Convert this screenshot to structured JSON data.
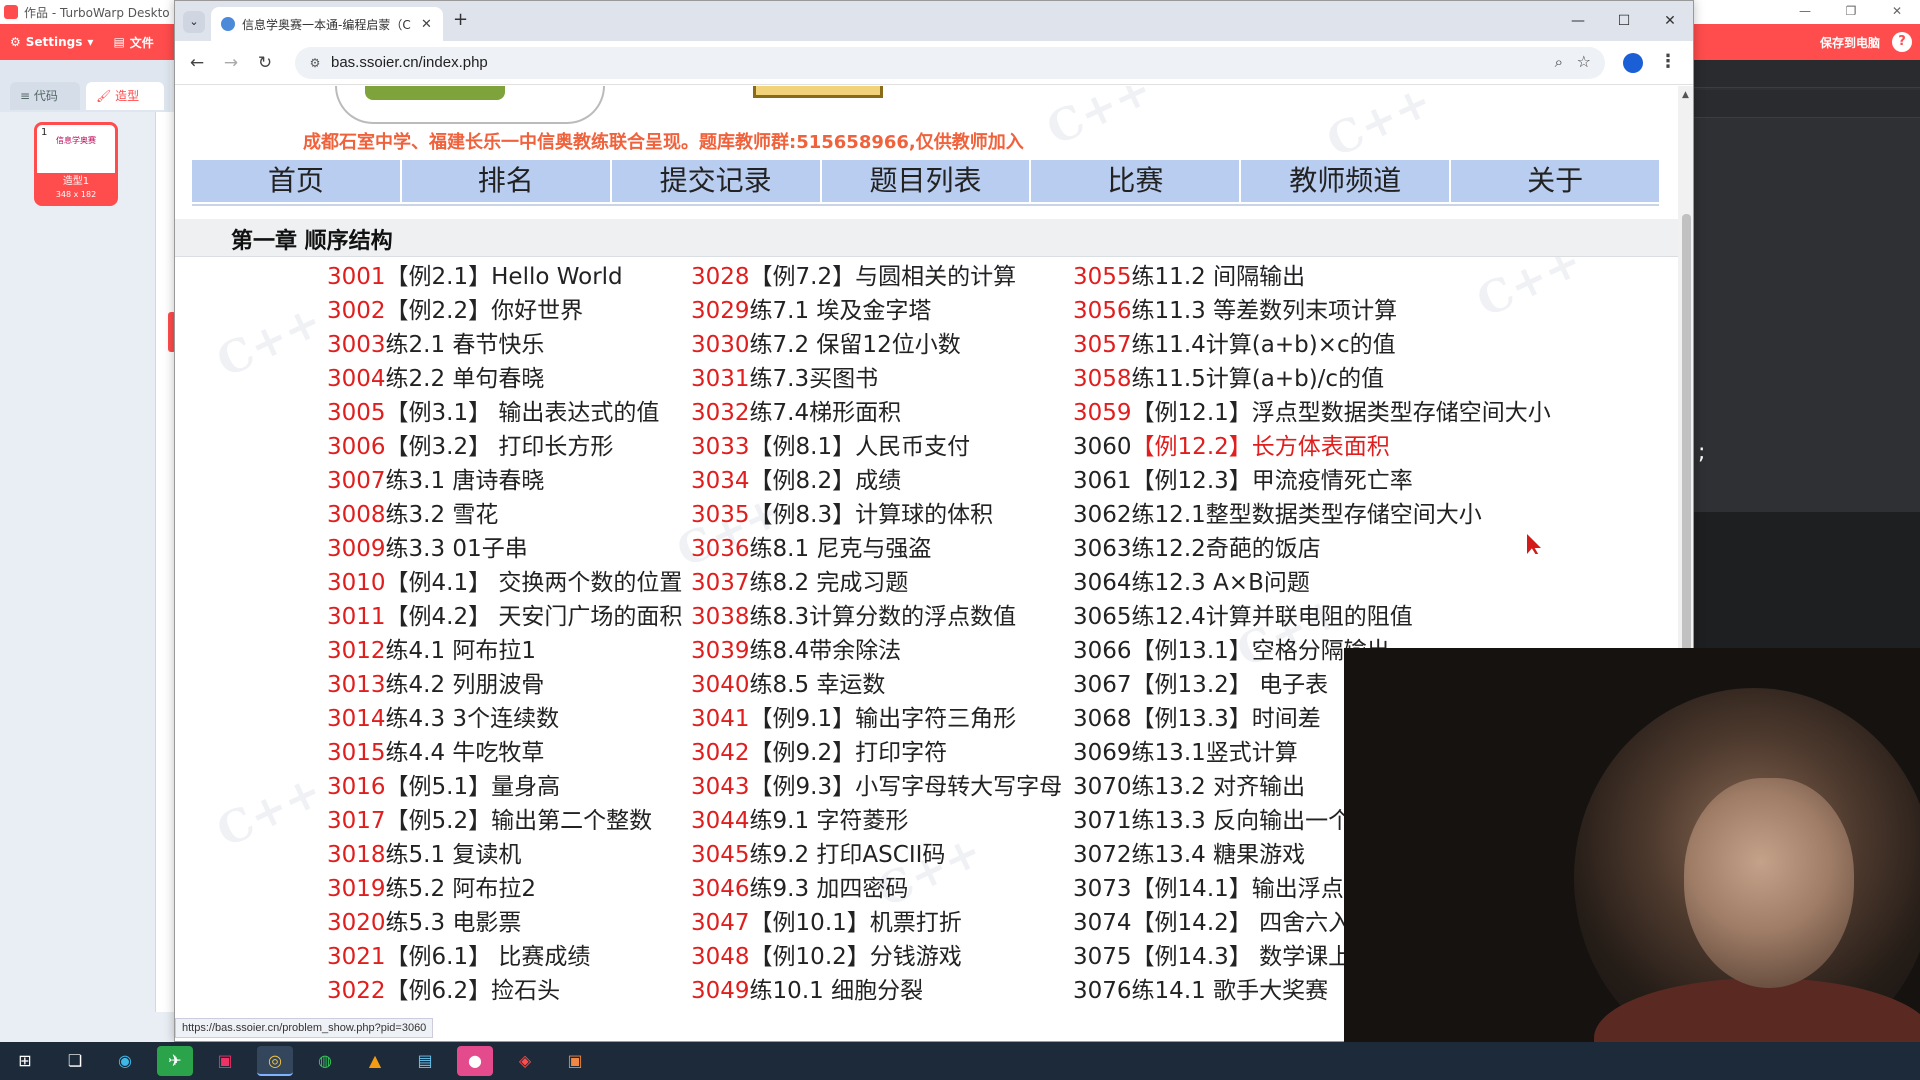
{
  "turbowarp": {
    "window_title": "作品 - TurboWarp Deskto",
    "menu": {
      "settings": "Settings",
      "file": "文件",
      "save_to_computer": "保存到电脑",
      "help": "?"
    },
    "tabs": {
      "code": "代码",
      "costume": "造型"
    },
    "costume": {
      "number": "1",
      "thumb_text": "信息学奥赛",
      "name": "造型1",
      "size": "348 x 182"
    },
    "semicolon": ";",
    "colors": {
      "accent": "#ff4c4c"
    }
  },
  "browser": {
    "tab_title": "信息学奥赛一本通-编程启蒙（C",
    "address": "bas.ssoier.cn/index.php",
    "status_url": "https://bas.ssoier.cn/problem_show.php?pid=3060"
  },
  "page": {
    "banner_text": "成都石室中学、福建长乐一中信奥教练联合呈现。题库教师群:515658966,仅供教师加入",
    "nav": [
      "首页",
      "排名",
      "提交记录",
      "题目列表",
      "比赛",
      "教师频道",
      "关于"
    ],
    "chapter_title": "第一章 顺序结构",
    "columns": [
      [
        {
          "id": "3001",
          "title": "【例2.1】Hello World"
        },
        {
          "id": "3002",
          "title": "【例2.2】你好世界"
        },
        {
          "id": "3003",
          "title": "练2.1 春节快乐"
        },
        {
          "id": "3004",
          "title": "练2.2 单句春晓"
        },
        {
          "id": "3005",
          "title": "【例3.1】 输出表达式的值"
        },
        {
          "id": "3006",
          "title": "【例3.2】 打印长方形"
        },
        {
          "id": "3007",
          "title": "练3.1 唐诗春晓"
        },
        {
          "id": "3008",
          "title": "练3.2 雪花"
        },
        {
          "id": "3009",
          "title": "练3.3 01子串"
        },
        {
          "id": "3010",
          "title": "【例4.1】 交换两个数的位置"
        },
        {
          "id": "3011",
          "title": "【例4.2】 天安门广场的面积"
        },
        {
          "id": "3012",
          "title": "练4.1 阿布拉1"
        },
        {
          "id": "3013",
          "title": "练4.2 列朋波骨"
        },
        {
          "id": "3014",
          "title": "练4.3 3个连续数"
        },
        {
          "id": "3015",
          "title": "练4.4 牛吃牧草"
        },
        {
          "id": "3016",
          "title": "【例5.1】量身高"
        },
        {
          "id": "3017",
          "title": "【例5.2】输出第二个整数"
        },
        {
          "id": "3018",
          "title": "练5.1 复读机"
        },
        {
          "id": "3019",
          "title": "练5.2 阿布拉2"
        },
        {
          "id": "3020",
          "title": "练5.3 电影票"
        },
        {
          "id": "3021",
          "title": "【例6.1】 比赛成绩"
        },
        {
          "id": "3022",
          "title": "【例6.2】捡石头"
        }
      ],
      [
        {
          "id": "3028",
          "title": "【例7.2】与圆相关的计算"
        },
        {
          "id": "3029",
          "title": "练7.1 埃及金字塔"
        },
        {
          "id": "3030",
          "title": "练7.2 保留12位小数"
        },
        {
          "id": "3031",
          "title": "练7.3买图书"
        },
        {
          "id": "3032",
          "title": "练7.4梯形面积"
        },
        {
          "id": "3033",
          "title": "【例8.1】人民币支付"
        },
        {
          "id": "3034",
          "title": "【例8.2】成绩"
        },
        {
          "id": "3035",
          "title": "【例8.3】计算球的体积"
        },
        {
          "id": "3036",
          "title": "练8.1 尼克与强盗"
        },
        {
          "id": "3037",
          "title": "练8.2 完成习题"
        },
        {
          "id": "3038",
          "title": "练8.3计算分数的浮点数值"
        },
        {
          "id": "3039",
          "title": "练8.4带余除法"
        },
        {
          "id": "3040",
          "title": "练8.5 幸运数"
        },
        {
          "id": "3041",
          "title": "【例9.1】输出字符三角形"
        },
        {
          "id": "3042",
          "title": "【例9.2】打印字符"
        },
        {
          "id": "3043",
          "title": "【例9.3】小写字母转大写字母"
        },
        {
          "id": "3044",
          "title": "练9.1 字符菱形"
        },
        {
          "id": "3045",
          "title": "练9.2 打印ASCII码"
        },
        {
          "id": "3046",
          "title": "练9.3 加四密码"
        },
        {
          "id": "3047",
          "title": "【例10.1】机票打折"
        },
        {
          "id": "3048",
          "title": "【例10.2】分钱游戏"
        },
        {
          "id": "3049",
          "title": "练10.1 细胞分裂"
        }
      ],
      [
        {
          "id": "3055",
          "title": "练11.2 间隔输出"
        },
        {
          "id": "3056",
          "title": "练11.3 等差数列末项计算"
        },
        {
          "id": "3057",
          "title": "练11.4计算(a+b)×c的值"
        },
        {
          "id": "3058",
          "title": "练11.5计算(a+b)/c的值"
        },
        {
          "id": "3059",
          "title": "【例12.1】浮点型数据类型存储空间大小"
        },
        {
          "id": "3060",
          "title": "【例12.2】长方体表面积"
        },
        {
          "id": "3061",
          "title": "【例12.3】甲流疫情死亡率"
        },
        {
          "id": "3062",
          "title": "练12.1整型数据类型存储空间大小"
        },
        {
          "id": "3063",
          "title": "练12.2奇葩的饭店"
        },
        {
          "id": "3064",
          "title": "练12.3 A×B问题"
        },
        {
          "id": "3065",
          "title": "练12.4计算并联电阻的阻值"
        },
        {
          "id": "3066",
          "title": "【例13.1】空格分隔输出"
        },
        {
          "id": "3067",
          "title": "【例13.2】 电子表"
        },
        {
          "id": "3068",
          "title": "【例13.3】时间差"
        },
        {
          "id": "3069",
          "title": "练13.1竖式计算"
        },
        {
          "id": "3070",
          "title": "练13.2 对齐输出"
        },
        {
          "id": "3071",
          "title": "练13.3 反向输出一个"
        },
        {
          "id": "3072",
          "title": "练13.4 糖果游戏"
        },
        {
          "id": "3073",
          "title": "【例14.1】输出浮点"
        },
        {
          "id": "3074",
          "title": "【例14.2】 四舍六入"
        },
        {
          "id": "3075",
          "title": "【例14.3】 数学课上"
        },
        {
          "id": "3076",
          "title": "练14.1 歌手大奖赛"
        }
      ]
    ],
    "done_from_index_col3": 5,
    "hover_index_col3": 5,
    "colors": {
      "id_red": "#e01e1e",
      "nav_bg": "#b9cdf0",
      "banner": "#f0623c"
    }
  }
}
